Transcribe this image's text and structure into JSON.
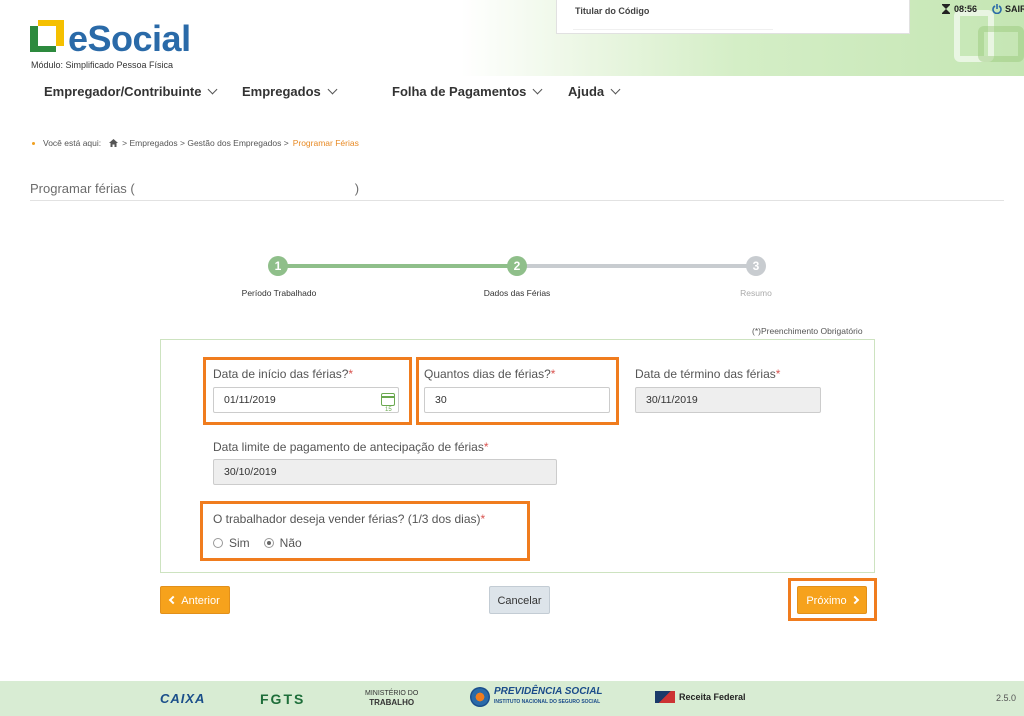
{
  "header": {
    "logo_text": "eSocial",
    "logo_sub": "Módulo: Simplificado Pessoa Física",
    "titular_label": "Titular do Código",
    "time": "08:56",
    "logout": "SAIR"
  },
  "nav": {
    "items": [
      {
        "label": "Empregador/Contribuinte"
      },
      {
        "label": "Empregados"
      },
      {
        "label": "Folha de Pagamentos"
      },
      {
        "label": "Ajuda"
      }
    ]
  },
  "breadcrumb": {
    "prefix": "Você está aqui:",
    "path": "> Empregados > Gestão dos Empregados >",
    "current": "Programar Férias"
  },
  "page": {
    "title_open": "Programar férias (",
    "title_close": ")"
  },
  "stepper": {
    "steps": [
      {
        "number": "1",
        "label": "Período Trabalhado"
      },
      {
        "number": "2",
        "label": "Dados das Férias"
      },
      {
        "number": "3",
        "label": "Resumo"
      }
    ],
    "current_step": 2
  },
  "form": {
    "required_note": "(*)Preenchimento Obrigatório",
    "start_date": {
      "label": "Data de início das férias?",
      "value": "01/11/2019"
    },
    "days": {
      "label": "Quantos dias de férias?",
      "value": "30"
    },
    "end_date": {
      "label": "Data de término das férias",
      "value": "30/11/2019"
    },
    "payment_limit": {
      "label": "Data limite de pagamento de antecipação de férias",
      "value": "30/10/2019"
    },
    "sell_vacation": {
      "label": "O trabalhador deseja vender férias? (1/3 dos dias)",
      "options": [
        "Sim",
        "Não"
      ],
      "selected": "Não"
    },
    "required_mark": "*"
  },
  "buttons": {
    "previous": "Anterior",
    "cancel": "Cancelar",
    "next": "Próximo"
  },
  "footer": {
    "caixa": "CAIXA",
    "fgts": "FGTS",
    "ministry_line1": "MINISTÉRIO DO",
    "ministry_line2": "TRABALHO",
    "previdencia": "PREVIDÊNCIA SOCIAL",
    "previdencia_sub": "INSTITUTO NACIONAL DO SEGURO SOCIAL",
    "receita": "Receita Federal",
    "version": "2.5.0"
  },
  "colors": {
    "brand_blue": "#2a6aa8",
    "step_active": "#8fbf8a",
    "step_inactive": "#c8ccd0",
    "highlight": "#f07c1e",
    "button_orange": "#f6a21c"
  }
}
